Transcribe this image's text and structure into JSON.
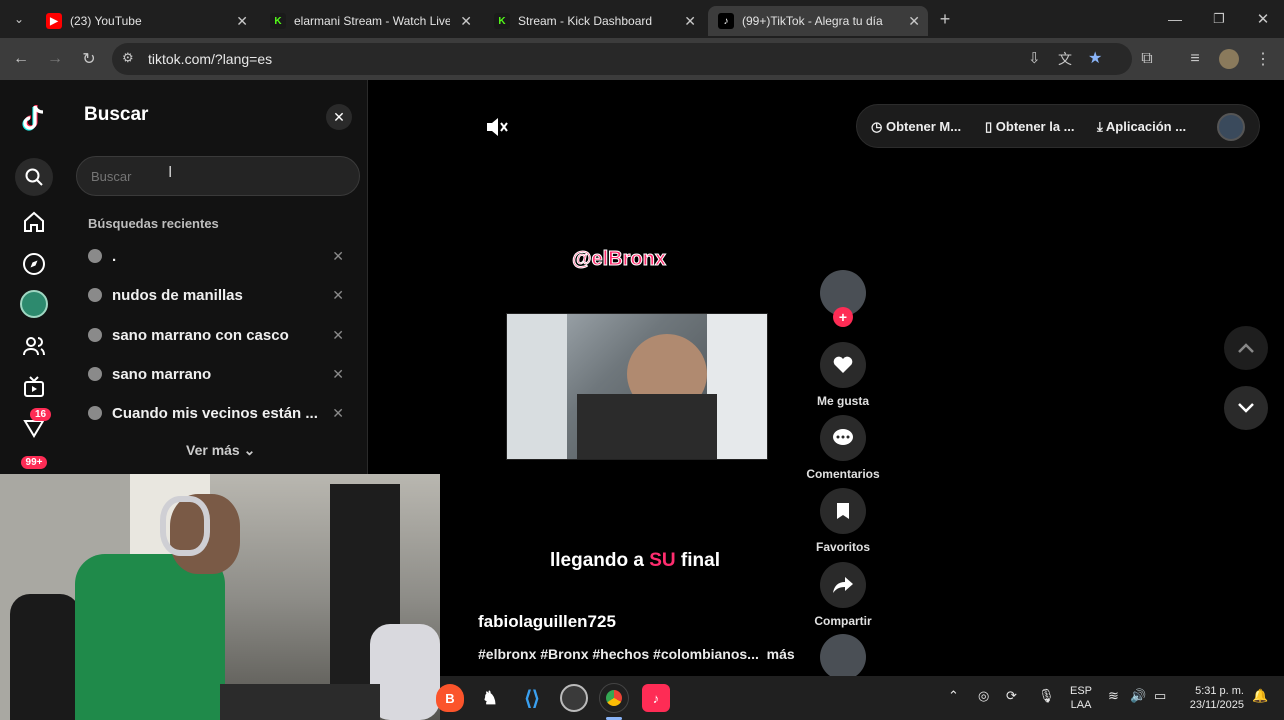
{
  "browser": {
    "tabs": [
      {
        "title": "(23) YouTube",
        "favicon": "youtube-icon",
        "color": "#ff0000"
      },
      {
        "title": "elarmani Stream - Watch Live o",
        "favicon": "kick-icon",
        "color": "#53fc18"
      },
      {
        "title": "Stream - Kick Dashboard",
        "favicon": "kick-icon",
        "color": "#53fc18"
      },
      {
        "title": "(99+)TikTok - Alegra tu día",
        "favicon": "tiktok-icon",
        "color": "#ffffff"
      }
    ],
    "url": "tiktok.com/?lang=es"
  },
  "rail": {
    "badge_inbox": "16",
    "badge_profile": "99+"
  },
  "search_panel": {
    "title": "Buscar",
    "placeholder": "Buscar",
    "recent_label": "Búsquedas recientes",
    "recent": [
      ".",
      "nudos de manillas",
      "sano marrano con casco",
      "sano marrano",
      "Cuando mis vecinos están ..."
    ],
    "see_more": "Ver más"
  },
  "top_bar": {
    "item1": "Obtener M...",
    "item2": "Obtener la ...",
    "item3": "Aplicación ..."
  },
  "video": {
    "tag": "@elBronx",
    "caption_pre": "llegando a ",
    "caption_hl": "SU",
    "caption_post": " final",
    "author": "fabiolaguillen725",
    "hashtags": "#elbronx #Bronx #hechos #colombianos...",
    "more": "más"
  },
  "actions": {
    "like": "Me gusta",
    "comments": "Comentarios",
    "favorites": "Favoritos",
    "share": "Compartir"
  },
  "taskbar": {
    "lang_top": "ESP",
    "lang_bottom": "LAA",
    "time": "5:31 p. m.",
    "date": "23/11/2025"
  },
  "colors": {
    "accent": "#fe2c55",
    "bg": "#000000",
    "panel": "#121212"
  }
}
